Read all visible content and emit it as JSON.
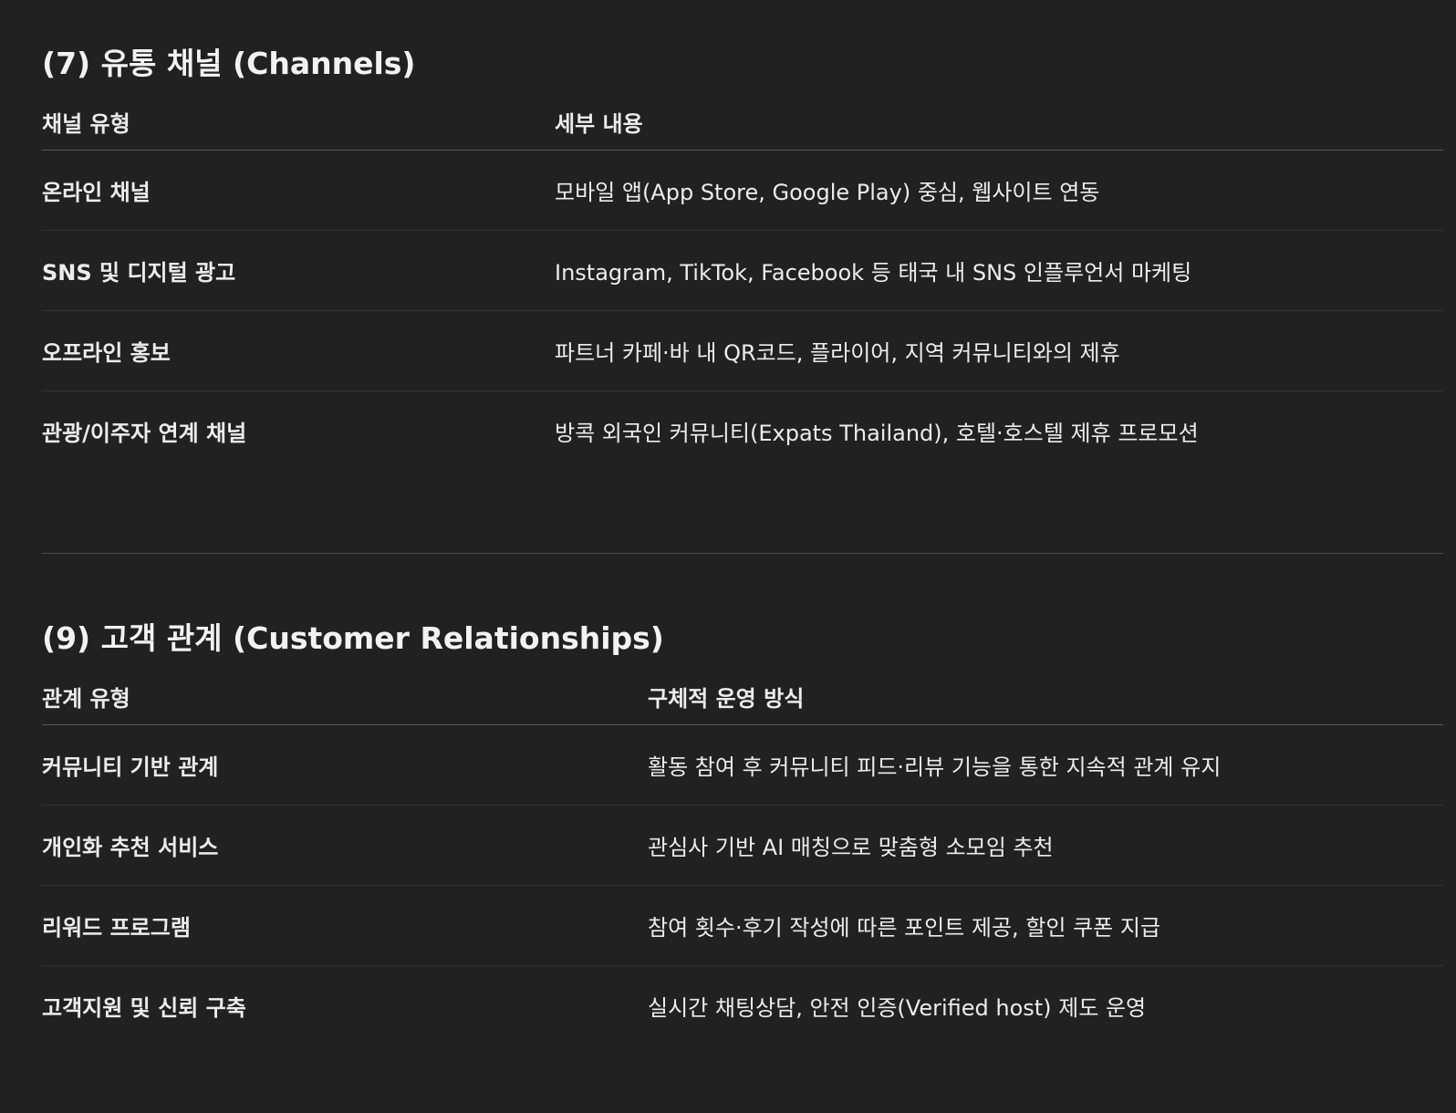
{
  "channels": {
    "title": "(7) 유통 채널 (Channels)",
    "headers": [
      "채널 유형",
      "세부 내용"
    ],
    "rows": [
      [
        "온라인 채널",
        "모바일 앱(App Store, Google Play) 중심, 웹사이트 연동"
      ],
      [
        "SNS 및 디지털 광고",
        "Instagram, TikTok, Facebook 등 태국 내 SNS 인플루언서 마케팅"
      ],
      [
        "오프라인 홍보",
        "파트너 카페·바 내 QR코드, 플라이어, 지역 커뮤니티와의 제휴"
      ],
      [
        "관광/이주자 연계 채널",
        "방콕 외국인 커뮤니티(Expats Thailand), 호텔·호스텔 제휴 프로모션"
      ]
    ]
  },
  "relationships": {
    "title": "(9) 고객 관계 (Customer Relationships)",
    "headers": [
      "관계 유형",
      "구체적 운영 방식"
    ],
    "rows": [
      [
        "커뮤니티 기반 관계",
        "활동 참여 후 커뮤니티 피드·리뷰 기능을 통한 지속적 관계 유지"
      ],
      [
        "개인화 추천 서비스",
        "관심사 기반 AI 매칭으로 맞춤형 소모임 추천"
      ],
      [
        "리워드 프로그램",
        "참여 횟수·후기 작성에 따른 포인트 제공, 할인 쿠폰 지급"
      ],
      [
        "고객지원 및 신뢰 구축",
        "실시간 채팅상담, 안전 인증(Verified host) 제도 운영"
      ]
    ]
  }
}
